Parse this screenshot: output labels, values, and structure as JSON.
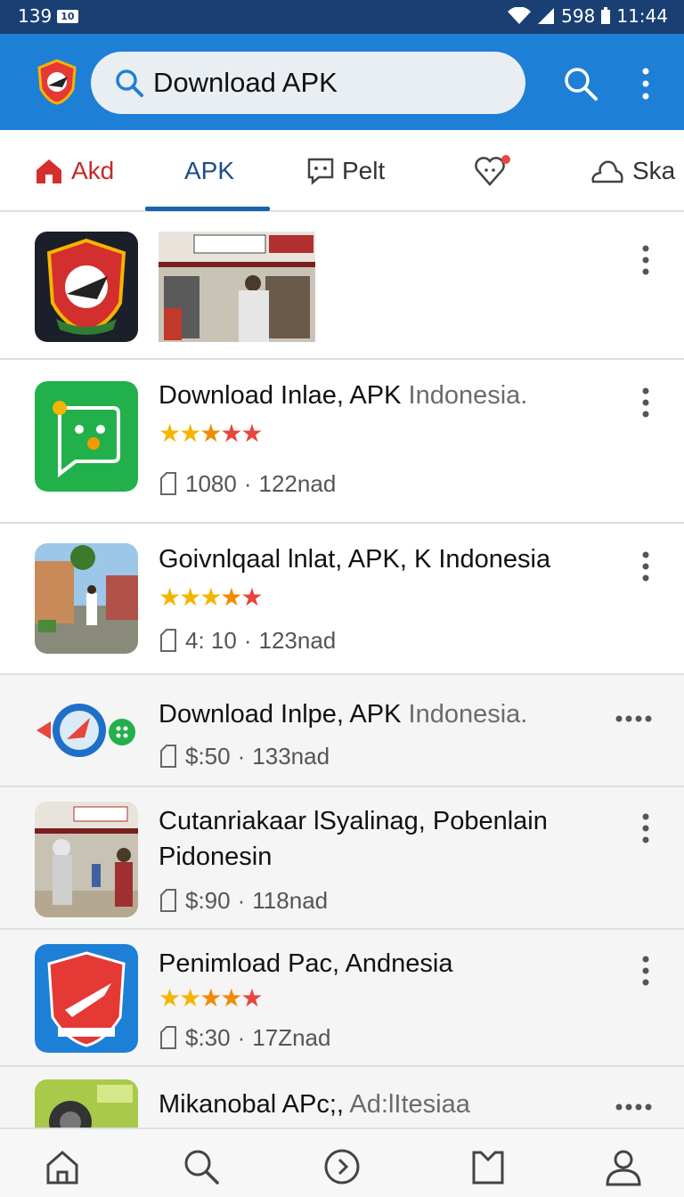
{
  "status_bar": {
    "time_left": "139",
    "badge": "10",
    "battery": "598",
    "clock": "11:44"
  },
  "search": {
    "value": "Download APK"
  },
  "tabs": [
    {
      "label": "Akd"
    },
    {
      "label": "APK"
    },
    {
      "label": "Pelt"
    },
    {
      "label": ""
    },
    {
      "label": "Ska"
    }
  ],
  "apps": [
    {
      "title": "Download Inlae, APK",
      "title_muted": "Indonesia.",
      "stars": "★★★★★",
      "meta_a": "1080",
      "meta_b": "122nad"
    },
    {
      "title": "Goivnlqaal lnlat, APK, K Indonesia",
      "title_muted": "",
      "stars": "★★★★★",
      "meta_a": "4: 10",
      "meta_b": "123nad"
    },
    {
      "title": "Download Inlpe, APK",
      "title_muted": "Indonesia.",
      "meta_a": "$:50",
      "meta_b": "133nad"
    },
    {
      "title": "Cutanriakaar lSyalinag, Pobenlain Pidonesin",
      "title_muted": "",
      "meta_a": "$:90",
      "meta_b": "118nad"
    },
    {
      "title": "Penimload Pac, Andnesia",
      "title_muted": "",
      "stars": "★★★★★",
      "meta_a": "$:30",
      "meta_b": "17Znad"
    },
    {
      "title": "Mikanobal APc;,",
      "title_muted": "Ad:lItesiaa"
    }
  ],
  "colors": {
    "appbar": "#1e7fd6",
    "status_bar": "#1a3f73",
    "accent": "#1a62b0",
    "star_yellow": "#f5b400",
    "star_red": "#e8453c"
  }
}
